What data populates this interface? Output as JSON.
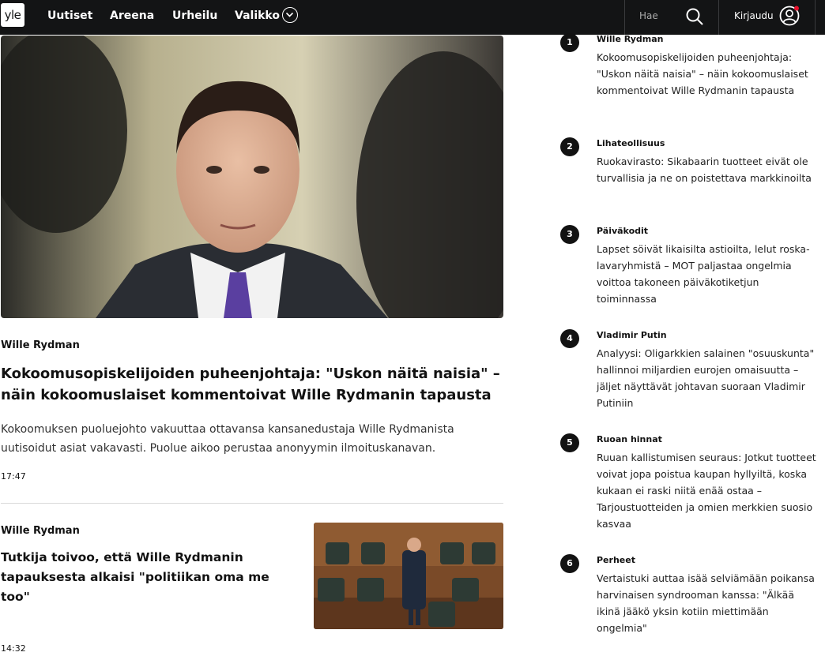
{
  "nav": {
    "logo": "yle",
    "items": [
      "Uutiset",
      "Areena",
      "Urheilu",
      "Valikko"
    ],
    "search_placeholder": "Hae",
    "login": "Kirjaudu",
    "notification_color": "#e8112d"
  },
  "main_story": {
    "kicker": "Wille Rydman",
    "title": "Kokoomusopiskelijoiden puheenjohtaja: \"Uskon näitä naisia\" – näin kokoomuslaiset kommentoivat Wille Rydmanin tapausta",
    "lead": "Kokoomuksen puoluejohto vakuuttaa ottavansa kansanedustaja Wille Rydmanista uutisoidut asiat vakavasti. Puolue aikoo perustaa anonyymin ilmoituskanavan.",
    "time": "17:47"
  },
  "second_story": {
    "kicker": "Wille Rydman",
    "title": "Tutkija toivoo, että Wille Rydmanin tapauksesta alkaisi \"politiikan oma me too\"",
    "time": "14:32"
  },
  "most_read": [
    {
      "rank": "1",
      "kicker": "Wille Rydman",
      "title": "Kokoomusopiskelijoiden puheenjohtaja: \"Uskon näitä naisia\" – näin kokoomuslai­set kommentoivat Wille Rydmanin tapausta"
    },
    {
      "rank": "2",
      "kicker": "Lihateollisuus",
      "title": "Ruokavirasto: Sikabaarin tuotteet eivät ole turvallisia ja ne on poistettava markkinoilta"
    },
    {
      "rank": "3",
      "kicker": "Päiväkodit",
      "title": "Lapset söivät likaisilta astioilta, lelut roska­lavaryhmistä – MOT paljastaa ongelmia voittoa takoneen päiväkotiketjun toiminnassa"
    },
    {
      "rank": "4",
      "kicker": "Vladimir Putin",
      "title": "Analyysi: Oligarkkien salainen \"osuuskunta\" hallinnoi miljardien eurojen omaisuutta – jäljet näyttävät johtavan suoraan Vladimir Putiniin"
    },
    {
      "rank": "5",
      "kicker": "Ruoan hinnat",
      "title": "Ruuan kallistumisen seuraus: Jotkut tuotteet voivat jopa poistua kaupan hyllyiltä, koska kukaan ei raski niitä enää ostaa – Tarjoustuotteiden ja omien merkkien suosio kasvaa"
    },
    {
      "rank": "6",
      "kicker": "Perheet",
      "title": "Vertaistuki auttaa isää selviämään poikansa harvinaisen syndrooman kanssa: \"Älkää ikinä jääkö yksin kotiin miettimään ongelmia\""
    }
  ]
}
